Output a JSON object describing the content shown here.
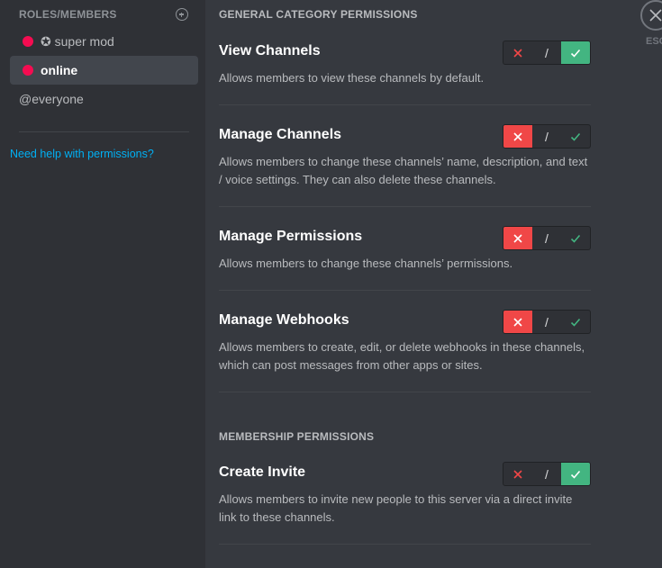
{
  "sidebar": {
    "header": "ROLES/MEMBERS",
    "roles": [
      {
        "label": "✪ super mod",
        "color": "#f50c51"
      },
      {
        "label": "online",
        "color": "#f50c51"
      },
      {
        "label": "@everyone"
      }
    ],
    "help_link": "Need help with permissions?"
  },
  "sections": {
    "general": "GENERAL CATEGORY PERMISSIONS",
    "membership": "MEMBERSHIP PERMISSIONS"
  },
  "permissions": [
    {
      "title": "View Channels",
      "desc": "Allows members to view these channels by default.",
      "state": "allow"
    },
    {
      "title": "Manage Channels",
      "desc": "Allows members to change these channels’ name, description, and text / voice settings. They can also delete these channels.",
      "state": "deny"
    },
    {
      "title": "Manage Permissions",
      "desc": "Allows members to change these channels’ permissions.",
      "state": "deny"
    },
    {
      "title": "Manage Webhooks",
      "desc": "Allows members to create, edit, or delete webhooks in these channels, which can post messages from other apps or sites.",
      "state": "deny"
    },
    {
      "title": "Create Invite",
      "desc": "Allows members to invite new people to this server via a direct invite link to these channels.",
      "state": "allow"
    }
  ],
  "toggle": {
    "neutral": "/"
  },
  "close": {
    "label": "ESC"
  },
  "colors": {
    "deny": "#f04747",
    "allow": "#43b581",
    "link": "#00b0f4"
  }
}
